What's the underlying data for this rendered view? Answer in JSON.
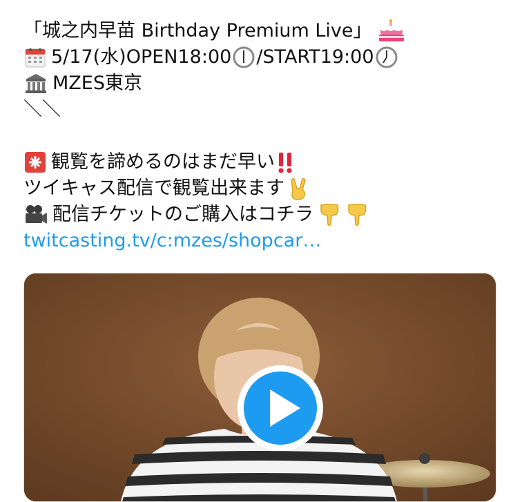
{
  "tweet": {
    "line1": "「城之内早苗 Birthday Premium Live」",
    "line2_date": "5/17(水)OPEN18:00",
    "line2_start": "/START19:00",
    "line3": "MZES東京",
    "line4": "＼＼",
    "line6": "観覧を諦めるのはまだ早い",
    "line7": "ツイキャス配信で観覧出来ます",
    "line8": "配信チケットのご購入はコチラ",
    "link": "twitcasting.tv/c:mzes/shopcar…"
  },
  "icons": {
    "cake": "birthday-cake-icon",
    "calendar": "calendar-icon",
    "clock_open": "clock-six-icon",
    "clock_start": "clock-seven-icon",
    "museum": "classical-building-icon",
    "siren": "siren-icon",
    "exclamation": "double-exclamation-icon",
    "peace": "victory-hand-icon",
    "camera": "movie-camera-icon",
    "pointing": "backhand-index-pointing-down-icon",
    "play": "play-icon"
  },
  "colors": {
    "link": "#1d9bf0",
    "play_button": "#1d9bf0",
    "media_background": "#7b5030"
  }
}
